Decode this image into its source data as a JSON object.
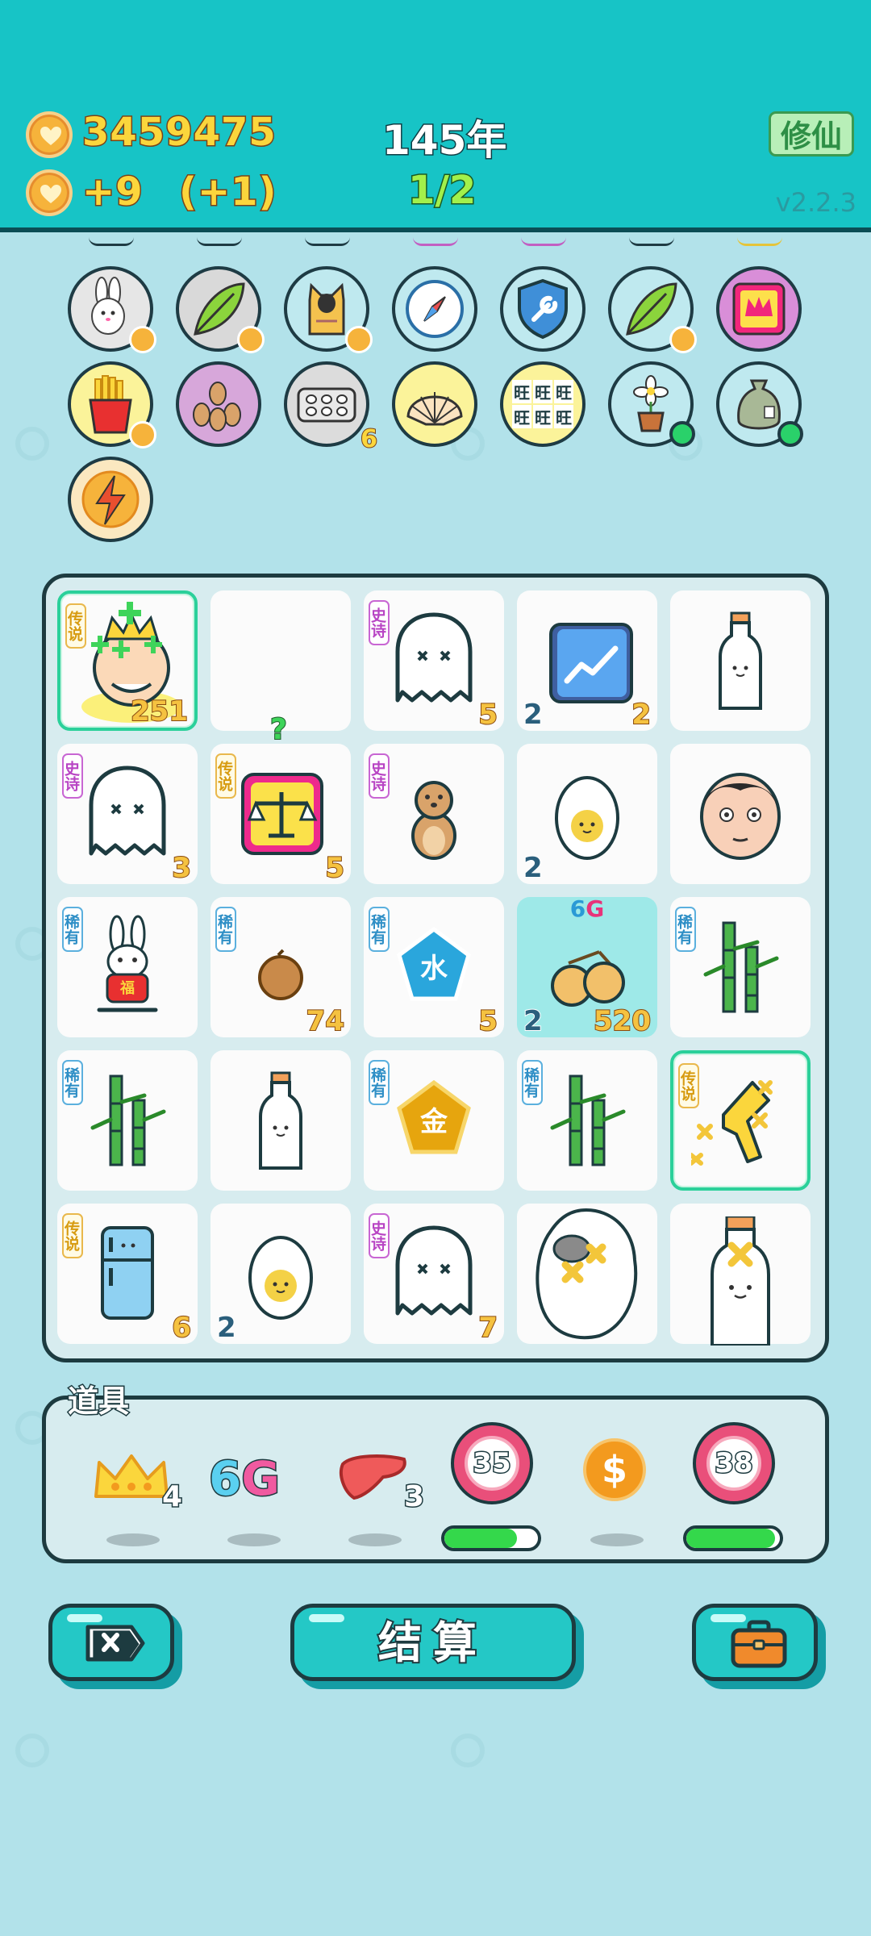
{
  "header": {
    "coins": "3459475",
    "income": "+9",
    "income_bonus": "(+1)",
    "year": "145年",
    "round": "1/2",
    "cultivate_button": "修仙",
    "version": "v2.2.3"
  },
  "symbols": [
    {
      "name": "rabbit",
      "bg": "#e6e6e6",
      "badge": "heart"
    },
    {
      "name": "leaf",
      "bg": "#d9d9d9",
      "badge": "heart"
    },
    {
      "name": "cat",
      "bg": "#bfe9ef",
      "badge": "heart"
    },
    {
      "name": "compass",
      "bg": "#bfe9ef"
    },
    {
      "name": "shield-wrench",
      "bg": "#bfe9ef"
    },
    {
      "name": "leaf",
      "bg": "#bfe9ef",
      "badge": "heart"
    },
    {
      "name": "crown-box",
      "bg": "#d98ed8"
    },
    {
      "name": "fries",
      "bg": "#fbf39a",
      "badge": "heart"
    },
    {
      "name": "meerkats",
      "bg": "#d7a7da"
    },
    {
      "name": "egg-carton",
      "bg": "#dcdcdc",
      "count": "6"
    },
    {
      "name": "shell",
      "bg": "#fbf39a"
    },
    {
      "name": "wang-text",
      "bg": "#fbf39a",
      "text": "旺"
    },
    {
      "name": "flower-pot",
      "bg": "#bfe9ef",
      "badge": "green"
    },
    {
      "name": "sack",
      "bg": "#bfe9ef",
      "badge": "green"
    },
    {
      "name": "lightning",
      "bg": "#fbe8c0"
    }
  ],
  "board": [
    {
      "item": "crowned-head",
      "tag": "传说",
      "rarity": "legend",
      "right": "251",
      "selected": true
    },
    {
      "item": "empty"
    },
    {
      "item": "ghost",
      "tag": "史诗",
      "rarity": "epic",
      "right": "5"
    },
    {
      "item": "chart-card",
      "left": "2",
      "right": "2"
    },
    {
      "item": "milk"
    },
    {
      "item": "ghost",
      "tag": "史诗",
      "rarity": "epic",
      "right": "3"
    },
    {
      "item": "scale",
      "tag": "传说",
      "rarity": "legend",
      "right": "5",
      "question": "?"
    },
    {
      "item": "meerkat",
      "tag": "史诗",
      "rarity": "epic"
    },
    {
      "item": "egg",
      "left": "2"
    },
    {
      "item": "face"
    },
    {
      "item": "rabbit-red",
      "tag": "稀有",
      "rarity": "rare",
      "rabbit_text": "福"
    },
    {
      "item": "nut",
      "tag": "稀有",
      "rarity": "rare",
      "right": "74"
    },
    {
      "item": "water-gem",
      "tag": "稀有",
      "rarity": "rare",
      "gem_text": "水",
      "right": "5"
    },
    {
      "item": "longan",
      "left": "2",
      "right": "520",
      "top": "6G",
      "cyan": true
    },
    {
      "item": "bamboo",
      "tag": "稀有",
      "rarity": "rare"
    },
    {
      "item": "bamboo",
      "tag": "稀有",
      "rarity": "rare"
    },
    {
      "item": "milk"
    },
    {
      "item": "gold-gem",
      "tag": "稀有",
      "rarity": "rare",
      "gem_text": "金"
    },
    {
      "item": "bamboo",
      "tag": "稀有",
      "rarity": "rare"
    },
    {
      "item": "hand",
      "tag": "传说",
      "rarity": "legend",
      "selected": true
    },
    {
      "item": "fridge",
      "tag": "传说",
      "rarity": "legend",
      "right": "6"
    },
    {
      "item": "egg",
      "left": "2"
    },
    {
      "item": "ghost",
      "tag": "史诗",
      "rarity": "epic",
      "right": "7"
    },
    {
      "item": "sheep"
    },
    {
      "item": "milk-big"
    }
  ],
  "props": {
    "title": "道具",
    "items": [
      {
        "name": "crown",
        "count": "4"
      },
      {
        "name": "6g",
        "text": "6G"
      },
      {
        "name": "liver",
        "count": "3"
      },
      {
        "name": "target",
        "value": "35",
        "progress": 0.78
      },
      {
        "name": "dollar-coin",
        "text": "$"
      },
      {
        "name": "target",
        "value": "38",
        "progress": 0.95
      }
    ]
  },
  "buttons": {
    "close_icon": "close-icon",
    "settle_label": "结算",
    "bag_icon": "briefcase-icon"
  },
  "colors": {
    "header": "#17c4c6",
    "background": "#b2e2ea",
    "accent": "#24c8c6",
    "epic": "#b844c4",
    "legend": "#d79b10",
    "rare": "#2f8fc6"
  }
}
